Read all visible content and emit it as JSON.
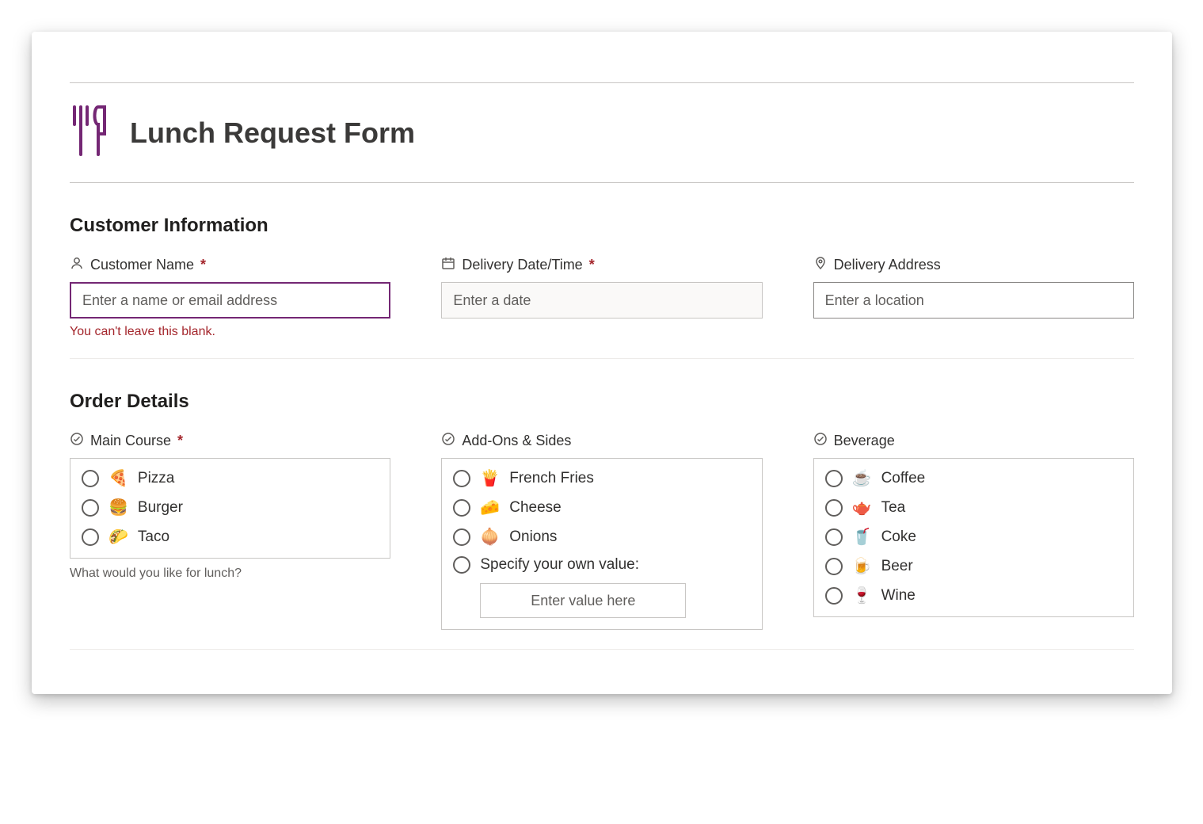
{
  "form": {
    "title": "Lunch Request Form"
  },
  "sections": {
    "customer_info": {
      "title": "Customer Information"
    },
    "order_details": {
      "title": "Order Details"
    }
  },
  "fields": {
    "customer_name": {
      "label": "Customer Name",
      "required_marker": "*",
      "placeholder": "Enter a name or email address",
      "error": "You can't leave this blank."
    },
    "delivery_datetime": {
      "label": "Delivery Date/Time",
      "required_marker": "*",
      "placeholder": "Enter a date"
    },
    "delivery_address": {
      "label": "Delivery Address",
      "placeholder": "Enter a location"
    },
    "main_course": {
      "label": "Main Course",
      "required_marker": "*",
      "helper": "What would you like for lunch?",
      "options": [
        {
          "emoji": "🍕",
          "text": "Pizza"
        },
        {
          "emoji": "🍔",
          "text": "Burger"
        },
        {
          "emoji": "🌮",
          "text": "Taco"
        }
      ]
    },
    "addons": {
      "label": "Add-Ons & Sides",
      "options": [
        {
          "emoji": "🍟",
          "text": "French Fries"
        },
        {
          "emoji": "🧀",
          "text": "Cheese"
        },
        {
          "emoji": "🧅",
          "text": "Onions"
        }
      ],
      "own_value_label": "Specify your own value:",
      "own_value_placeholder": "Enter value here"
    },
    "beverage": {
      "label": "Beverage",
      "options": [
        {
          "emoji": "☕",
          "text": "Coffee"
        },
        {
          "emoji": "🫖",
          "text": "Tea"
        },
        {
          "emoji": "🥤",
          "text": "Coke"
        },
        {
          "emoji": "🍺",
          "text": "Beer"
        },
        {
          "emoji": "🍷",
          "text": "Wine"
        }
      ]
    }
  },
  "colors": {
    "accent": "#742774",
    "error": "#a4262c"
  }
}
